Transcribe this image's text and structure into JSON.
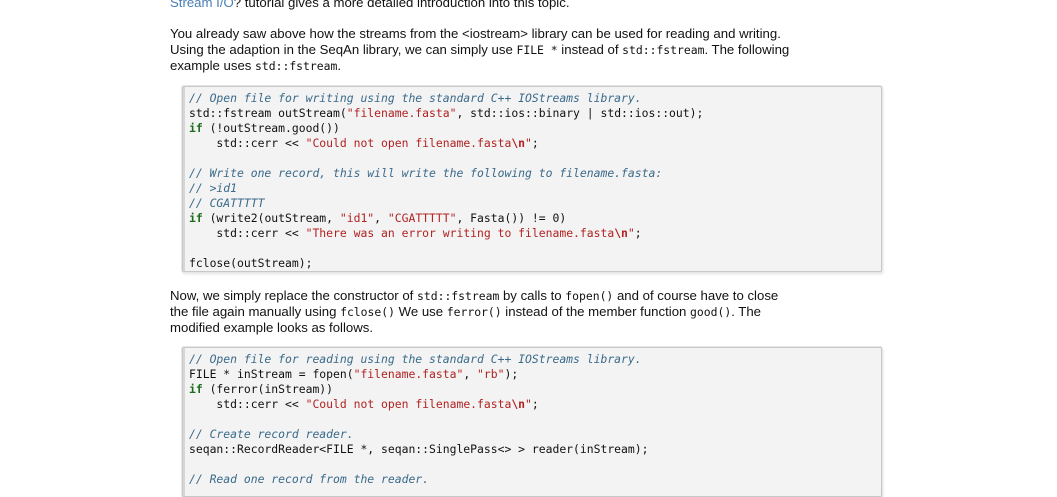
{
  "intro": {
    "link_text": "Stream I/O",
    "rest_text": "? tutorial gives a more detailed introduction into this topic."
  },
  "para1": {
    "t1": "You already saw above how the streams from the <iostream> library can be used for reading and writing.",
    "t2": "Using the adaption in the SeqAn library, we can simply use ",
    "c1": "FILE *",
    "t3": " instead of ",
    "c2": "std::fstream",
    "t4": ". The following",
    "t5": "example uses ",
    "c3": "std::fstream",
    "t6": "."
  },
  "code1": {
    "l1": "// Open file for writing using the standard C++ IOStreams library.",
    "l2a": "std::fstream outStream(",
    "l2s": "\"filename.fasta\"",
    "l2b": ", std::ios::binary | std::ios::out);",
    "l3k": "if",
    "l3b": " (!outStream.good())",
    "l4a": "    std::cerr << ",
    "l4s": "\"Could not open filename.fasta",
    "l4e": "\\n",
    "l4t": "\"",
    "l4b": ";",
    "l5": "// Write one record, this will write the following to filename.fasta:",
    "l6": "// >id1",
    "l7": "// CGATTTTT",
    "l8k": "if",
    "l8a": " (write2(outStream, ",
    "l8s1": "\"id1\"",
    "l8b": ", ",
    "l8s2": "\"CGATTTTT\"",
    "l8c": ", Fasta()) != 0)",
    "l9a": "    std::cerr << ",
    "l9s": "\"There was an error writing to filename.fasta",
    "l9e": "\\n",
    "l9t": "\"",
    "l9b": ";",
    "l10": "fclose(outStream);"
  },
  "para2": {
    "t1": "Now, we simply replace the constructor of ",
    "c1": "std::fstream",
    "t2": " by calls to ",
    "c2": "fopen()",
    "t3": " and of course have to close",
    "t4": "the file again manually using ",
    "c3": "fclose()",
    "t5": " We use ",
    "c4": "ferror()",
    "t6": " instead of the member function ",
    "c5": "good()",
    "t7": ". The",
    "t8": "modified example looks as follows."
  },
  "code2": {
    "l1": "// Open file for reading using the standard C++ IOStreams library.",
    "l2a": "FILE * inStream = fopen(",
    "l2s1": "\"filename.fasta\"",
    "l2b": ", ",
    "l2s2": "\"rb\"",
    "l2c": ");",
    "l3k": "if",
    "l3b": " (ferror(inStream))",
    "l4a": "    std::cerr << ",
    "l4s": "\"Could not open filename.fasta",
    "l4e": "\\n",
    "l4t": "\"",
    "l4b": ";",
    "l5": "// Create record reader.",
    "l6": "seqan::RecordReader<FILE *, seqan::SinglePass<> > reader(inStream);",
    "l7": "// Read one record from the reader."
  }
}
